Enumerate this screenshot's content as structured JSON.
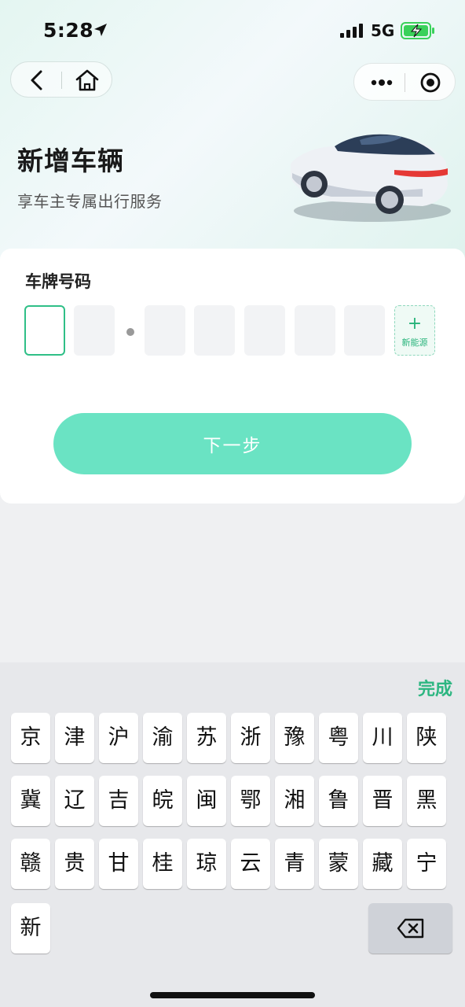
{
  "status_bar": {
    "time": "5:28",
    "network": "5G"
  },
  "header": {
    "title": "新增车辆",
    "subtitle": "享车主专属出行服务"
  },
  "form": {
    "plate_label": "车牌号码",
    "new_energy_label": "新能源",
    "next_label": "下一步"
  },
  "keyboard": {
    "done_label": "完成",
    "rows": [
      [
        "京",
        "津",
        "沪",
        "渝",
        "苏",
        "浙",
        "豫",
        "粤",
        "川",
        "陕"
      ],
      [
        "冀",
        "辽",
        "吉",
        "皖",
        "闽",
        "鄂",
        "湘",
        "鲁",
        "晋",
        "黑"
      ],
      [
        "赣",
        "贵",
        "甘",
        "桂",
        "琼",
        "云",
        "青",
        "蒙",
        "藏",
        "宁"
      ],
      [
        "新"
      ]
    ]
  },
  "colors": {
    "accent": "#2fbf87",
    "button": "#6ae3c3",
    "battery_fill": "#3ad15a"
  },
  "icons": [
    "location-arrow-icon",
    "signal-icon",
    "battery-charging-icon",
    "back-icon",
    "home-icon",
    "more-icon",
    "close-circle-icon",
    "plus-icon",
    "backspace-icon"
  ]
}
